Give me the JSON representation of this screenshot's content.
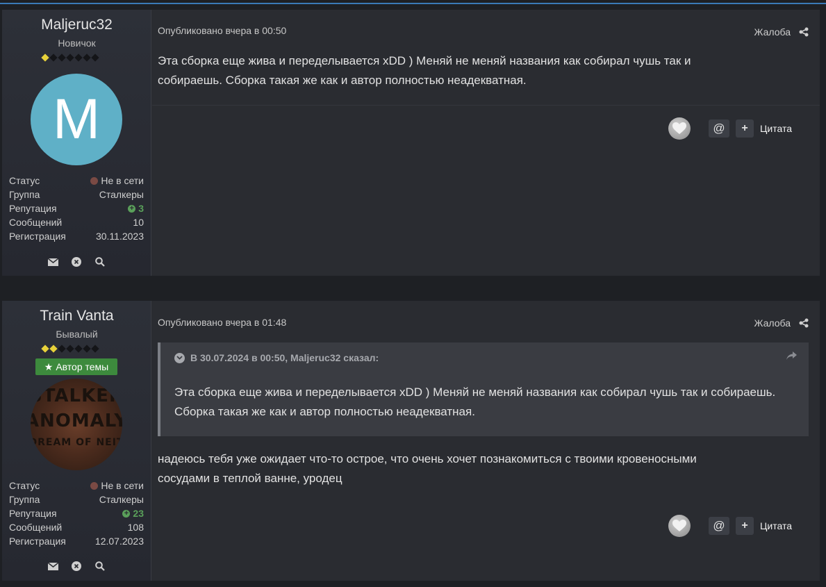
{
  "posts": [
    {
      "author": {
        "name": "Maljeruc32",
        "rank": "Новичок",
        "pips_on": 1,
        "pips_total": 7,
        "avatar_letter": "M",
        "avatar_color": "#5fb0c7",
        "stats": {
          "status_label": "Статус",
          "status_value": "Не в сети",
          "group_label": "Группа",
          "group_value": "Сталкеры",
          "rep_label": "Репутация",
          "rep_value": "3",
          "posts_label": "Сообщений",
          "posts_value": "10",
          "reg_label": "Регистрация",
          "reg_value": "30.11.2023"
        }
      },
      "meta": "Опубликовано вчера в 00:50",
      "report": "Жалоба",
      "text": "Эта сборка еще жива и переделывается xDD ) Меняй не меняй названия как собирал чушь так и собираешь. Сборка такая же как и автор полностью неадекватная.",
      "quote_label": "Цитата",
      "mention_glyph": "@",
      "plus_glyph": "+"
    },
    {
      "author": {
        "name": "Train Vanta",
        "rank": "Бывалый",
        "pips_on": 2,
        "pips_total": 7,
        "badge": "Автор темы",
        "avatar_text": [
          "STALKER",
          "ANOMALY",
          "DREAM OF NEIT"
        ],
        "stats": {
          "status_label": "Статус",
          "status_value": "Не в сети",
          "group_label": "Группа",
          "group_value": "Сталкеры",
          "rep_label": "Репутация",
          "rep_value": "23",
          "posts_label": "Сообщений",
          "posts_value": "108",
          "reg_label": "Регистрация",
          "reg_value": "12.07.2023"
        }
      },
      "meta": "Опубликовано вчера в 01:48",
      "report": "Жалоба",
      "quote": {
        "header": "В 30.07.2024 в 00:50, Maljeruc32 сказал:",
        "text": "Эта сборка еще жива и переделывается xDD ) Меняй не меняй названия как собирал чушь так и собираешь. Сборка такая же как и автор полностью неадекватная."
      },
      "text": "надеюсь тебя уже ожидает что-то острое, что очень хочет познакомиться с твоими кровеносными сосудами в теплой ванне, уродец",
      "quote_label": "Цитата",
      "mention_glyph": "@",
      "plus_glyph": "+"
    }
  ],
  "colors": {
    "accent": "#3a7ab8",
    "badge": "#3d8a3d",
    "reputation": "#5aa05a",
    "offline": "#7a4a44",
    "pip_on": "#e8d23a"
  }
}
